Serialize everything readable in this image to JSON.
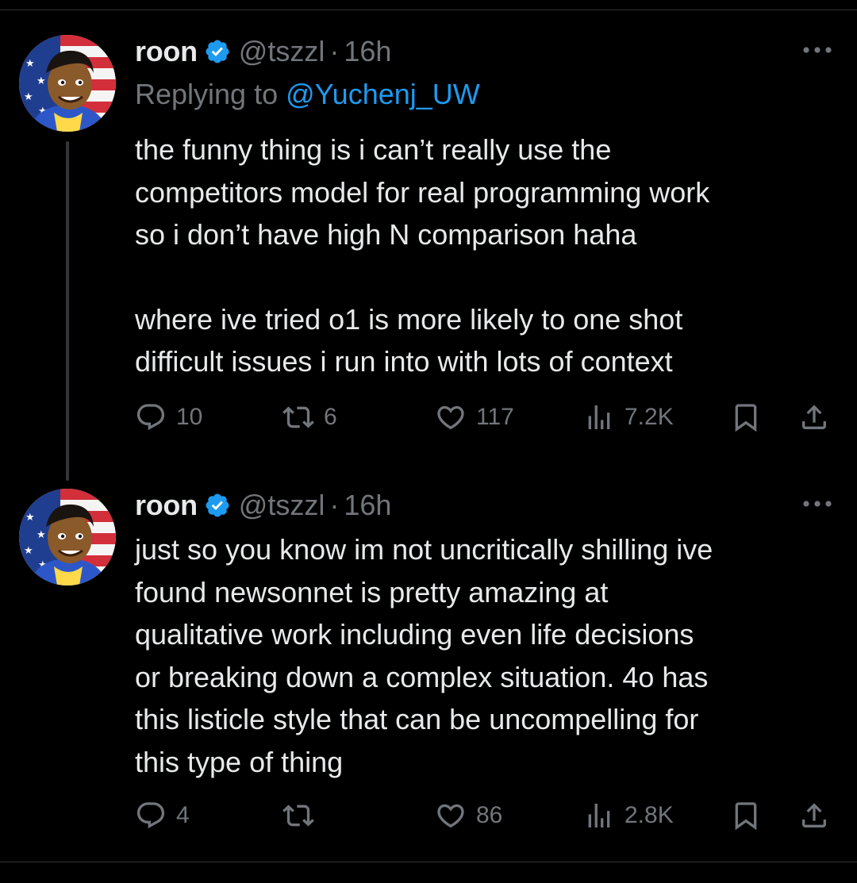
{
  "tweets": [
    {
      "author": {
        "name": "roon",
        "handle": "@tszzl",
        "verified": true,
        "avatar": "cartoon-avatar-american-flag"
      },
      "separator": "·",
      "time": "16h",
      "replying_prefix": "Replying to ",
      "replying_to": "@Yuchenj_UW",
      "text_paragraphs": [
        "the funny thing is i can’t really use the\ncompetitors model for real programming work\nso i don’t have high N comparison haha",
        "where ive tried o1 is more likely to one shot\ndifficult issues i run into with lots of context"
      ],
      "stats": {
        "replies": "10",
        "reposts": "6",
        "likes": "117",
        "views": "7.2K"
      }
    },
    {
      "author": {
        "name": "roon",
        "handle": "@tszzl",
        "verified": true,
        "avatar": "cartoon-avatar-american-flag"
      },
      "separator": "·",
      "time": "16h",
      "text_paragraphs": [
        "just so you know im not uncritically shilling ive\nfound newsonnet is pretty amazing at\nqualitative work including even life decisions\nor breaking down a complex situation. 4o has\nthis listicle style that can be uncompelling for\nthis type of thing"
      ],
      "stats": {
        "replies": "4",
        "reposts": "",
        "likes": "86",
        "views": "2.8K"
      }
    }
  ],
  "icons": {
    "reply": "speech-bubble-icon",
    "repost": "repost-arrows-icon",
    "like": "heart-icon",
    "views": "bar-chart-icon",
    "bookmark": "bookmark-icon",
    "share": "share-upload-icon",
    "more": "more-dots-icon",
    "verified": "verified-badge-icon"
  },
  "colors": {
    "background": "#000000",
    "text": "#e7e9ea",
    "secondary": "#71767b",
    "link": "#1d9bf0",
    "verified": "#1d9bf0",
    "divider": "#2f3336"
  }
}
